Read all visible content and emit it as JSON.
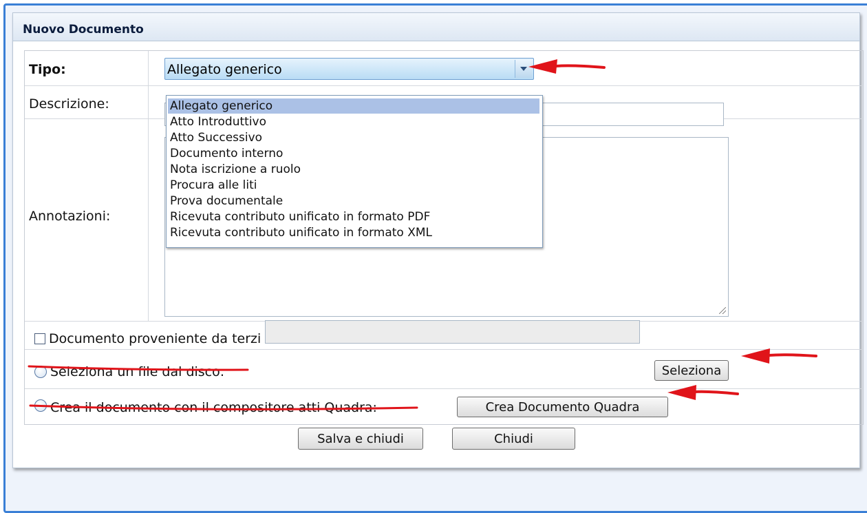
{
  "panel": {
    "title": "Nuovo Documento"
  },
  "form": {
    "tipo_label": "Tipo:",
    "tipo_selected": "Allegato generico",
    "descrizione_label": "Descrizione:",
    "annotazioni_label": "Annotazioni:",
    "tipo_options": [
      "Allegato generico",
      "Atto Introduttivo",
      "Atto Successivo",
      "Documento interno",
      "Nota iscrizione a ruolo",
      "Procura alle liti",
      "Prova documentale",
      "Ricevuta contributo unificato in formato PDF",
      "Ricevuta contributo unificato in formato XML"
    ],
    "terzi_label": "Documento proveniente da terzi",
    "seleziona_file_label": "Seleziona un file dal disco:",
    "seleziona_button": "Seleziona",
    "crea_quadra_label": "Crea il documento con il compositore atti Quadra:",
    "crea_quadra_button": "Crea Documento Quadra"
  },
  "footer": {
    "save_button": "Salva e chiudi",
    "close_button": "Chiudi"
  },
  "colors": {
    "frame": "#3a7fd6",
    "annotation": "#e0141a",
    "selected_option": "#abc1e6"
  }
}
